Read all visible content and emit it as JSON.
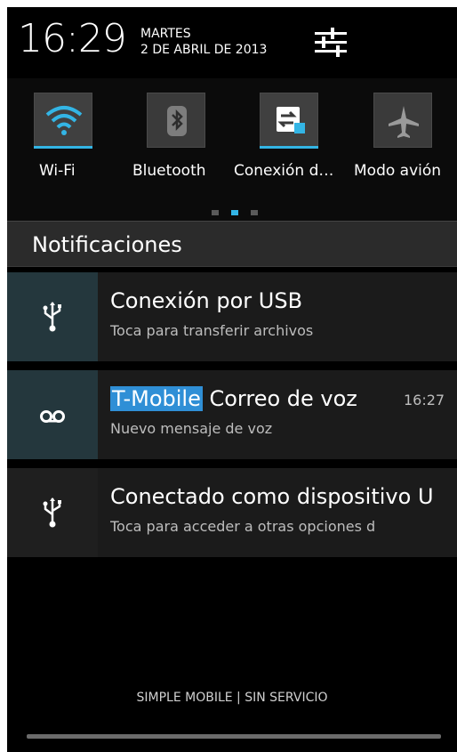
{
  "header": {
    "time": "16:29",
    "day": "MARTES",
    "date": "2 DE ABRIL DE 2013",
    "settings_icon": "settings-sliders-icon"
  },
  "quick_settings": {
    "tiles": [
      {
        "label": "Wi-Fi",
        "icon": "wifi-icon",
        "active": true
      },
      {
        "label": "Bluetooth",
        "icon": "bluetooth-icon",
        "active": false
      },
      {
        "label": "Conexión d…",
        "icon": "data-connection-icon",
        "active": true
      },
      {
        "label": "Modo avión",
        "icon": "airplane-icon",
        "active": false
      }
    ],
    "page_indicator": {
      "pages": 3,
      "current": 2
    }
  },
  "notifications": {
    "title": "Notificaciones",
    "items": [
      {
        "icon": "usb-icon",
        "title": "Conexión por USB",
        "subtitle": "Toca para transferir archivos"
      },
      {
        "icon": "voicemail-icon",
        "title_highlight": "T-Mobile",
        "title_rest": "Correo de voz",
        "time": "16:27",
        "subtitle": "Nuevo mensaje de voz"
      },
      {
        "icon": "usb-icon",
        "title": "Conectado como dispositivo U",
        "subtitle": "Toca para acceder a otras opciones d"
      }
    ]
  },
  "footer": {
    "carrier": "SIMPLE MOBILE | SIN SERVICIO"
  },
  "colors": {
    "accent": "#33b5e5",
    "highlight": "#2f8fd6",
    "background": "#000000"
  }
}
